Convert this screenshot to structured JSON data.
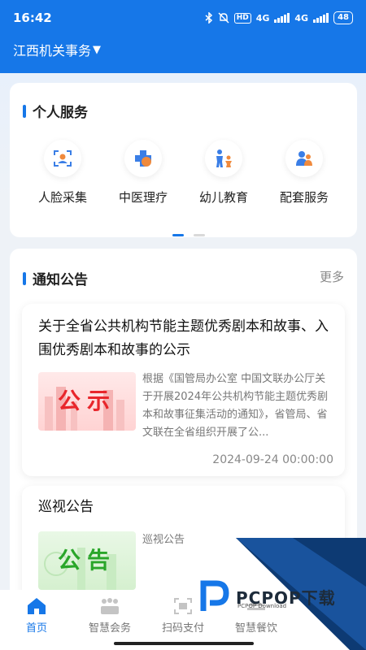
{
  "status_bar": {
    "time": "16:42",
    "hd": "HD",
    "net1": "4G",
    "net2": "4G",
    "battery": "48"
  },
  "header": {
    "title": "江西机关事务",
    "caret": "▼"
  },
  "personal_services": {
    "title": "个人服务",
    "items": [
      {
        "label": "人脸采集",
        "icon": "face-scan-icon"
      },
      {
        "label": "中医理疗",
        "icon": "medical-cross-icon"
      },
      {
        "label": "幼儿教育",
        "icon": "child-parent-icon"
      },
      {
        "label": "配套服务",
        "icon": "people-service-icon"
      }
    ]
  },
  "notices": {
    "title": "通知公告",
    "more": "更多",
    "items": [
      {
        "title": "关于全省公共机构节能主题优秀剧本和故事、入围优秀剧本和故事的公示",
        "thumb_text": "公示",
        "summary": "根据《国管局办公室 中国文联办公厅关于开展2024年公共机构节能主题优秀剧本和故事征集活动的通知》，省管局、省文联在全省组织开展了公...",
        "date": "2024-09-24 00:00:00"
      },
      {
        "title": "巡视公告",
        "thumb_text": "公告",
        "summary": "巡视公告"
      }
    ]
  },
  "tabbar": [
    {
      "label": "首页",
      "icon": "home-icon",
      "active": true
    },
    {
      "label": "智慧会务",
      "icon": "meeting-icon",
      "active": false
    },
    {
      "label": "扫码支付",
      "icon": "scan-icon",
      "active": false
    },
    {
      "label": "智慧餐饮",
      "icon": "dining-icon",
      "active": false
    }
  ],
  "watermark": {
    "text": "PCPOP下载",
    "sub": "PCPOP Download"
  },
  "colors": {
    "primary": "#1677e8",
    "background": "#eef2f7",
    "red": "#e8262b",
    "green": "#2aa62a"
  }
}
